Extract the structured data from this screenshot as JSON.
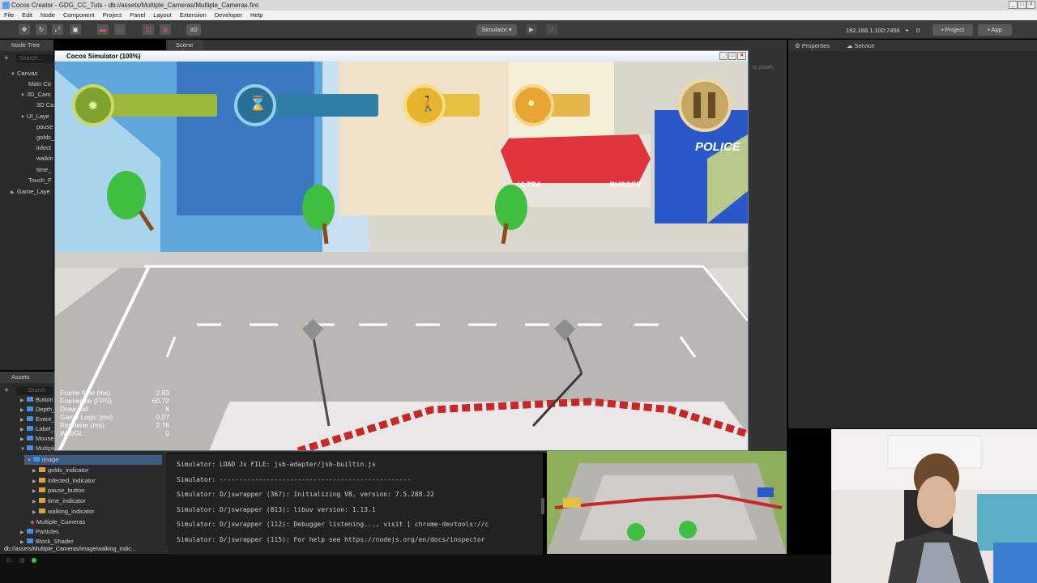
{
  "window": {
    "title": "Cocos Creator - GDG_CC_Tuts - db://assets/Multiple_Cameras/Multiple_Cameras.fire",
    "buttons": [
      "_",
      "□",
      "×"
    ]
  },
  "menu": [
    "File",
    "Edit",
    "Node",
    "Component",
    "Project",
    "Panel",
    "Layout",
    "Extension",
    "Developer",
    "Help"
  ],
  "toolbar": {
    "mode_3d": "3D",
    "simulator_label": "Simulator ▾",
    "ip_text": "192.168.1.100:7456",
    "wifi_count": "0",
    "project_button": "Project",
    "app_button": "App"
  },
  "node_tree": {
    "title": "Node Tree",
    "search_placeholder": "Search...",
    "items": [
      "Canvas",
      "Main Ca",
      "3D_Cam",
      "3D Ca",
      "UI_Laye",
      "pause",
      "golds_",
      "infect",
      "walkin",
      "time_",
      "Touch_F",
      "Game_Laye"
    ]
  },
  "scene_tab": "Scene",
  "scene_hint": "to zoom.",
  "properties_tab": "Properties",
  "service_tab": "Service",
  "assets": {
    "title": "Assets",
    "search_placeholder": "Search",
    "items": [
      "Button",
      "Depth_",
      "Event_",
      "Label_",
      "Mouse_",
      "Multiple",
      "image",
      "golds_indicator",
      "infected_indicator",
      "pause_button",
      "time_indicator",
      "walking_indicator",
      "Multiple_Cameras",
      "Particles",
      "Block_Shader"
    ]
  },
  "simulator": {
    "title": "Cocos Simulator (100%)",
    "police_sign": "POLICE",
    "shop_sign_left": "ULTRA",
    "shop_sign_right": "BURGER",
    "stats": [
      {
        "label": "Frame time (ms)",
        "value": "2.83"
      },
      {
        "label": "Framerate (FPS)",
        "value": "60.72"
      },
      {
        "label": "Draw call",
        "value": "6"
      },
      {
        "label": "Game Logic (ms)",
        "value": "0.07"
      },
      {
        "label": "Renderer (ms)",
        "value": "2.76"
      },
      {
        "label": "WebGL",
        "value": "0"
      }
    ]
  },
  "console": [
    "Simulator: LOAD Js FILE: jsb-adapter/jsb-builtin.js",
    "Simulator: -------------------------------------------------",
    "Simulator: D/jswrapper (367): Initializing V8, version: 7.5.288.22",
    "Simulator: D/jswrapper (813): libuv version: 1.13.1",
    "Simulator: D/jswrapper (112): Debugger listening..., visit [ chrome-devtools://c",
    "Simulator: D/jswrapper (115): For help see https://nodejs.org/en/docs/inspector"
  ],
  "status_path": "db://assets/Multiple_Cameras/image/walking_indic..."
}
